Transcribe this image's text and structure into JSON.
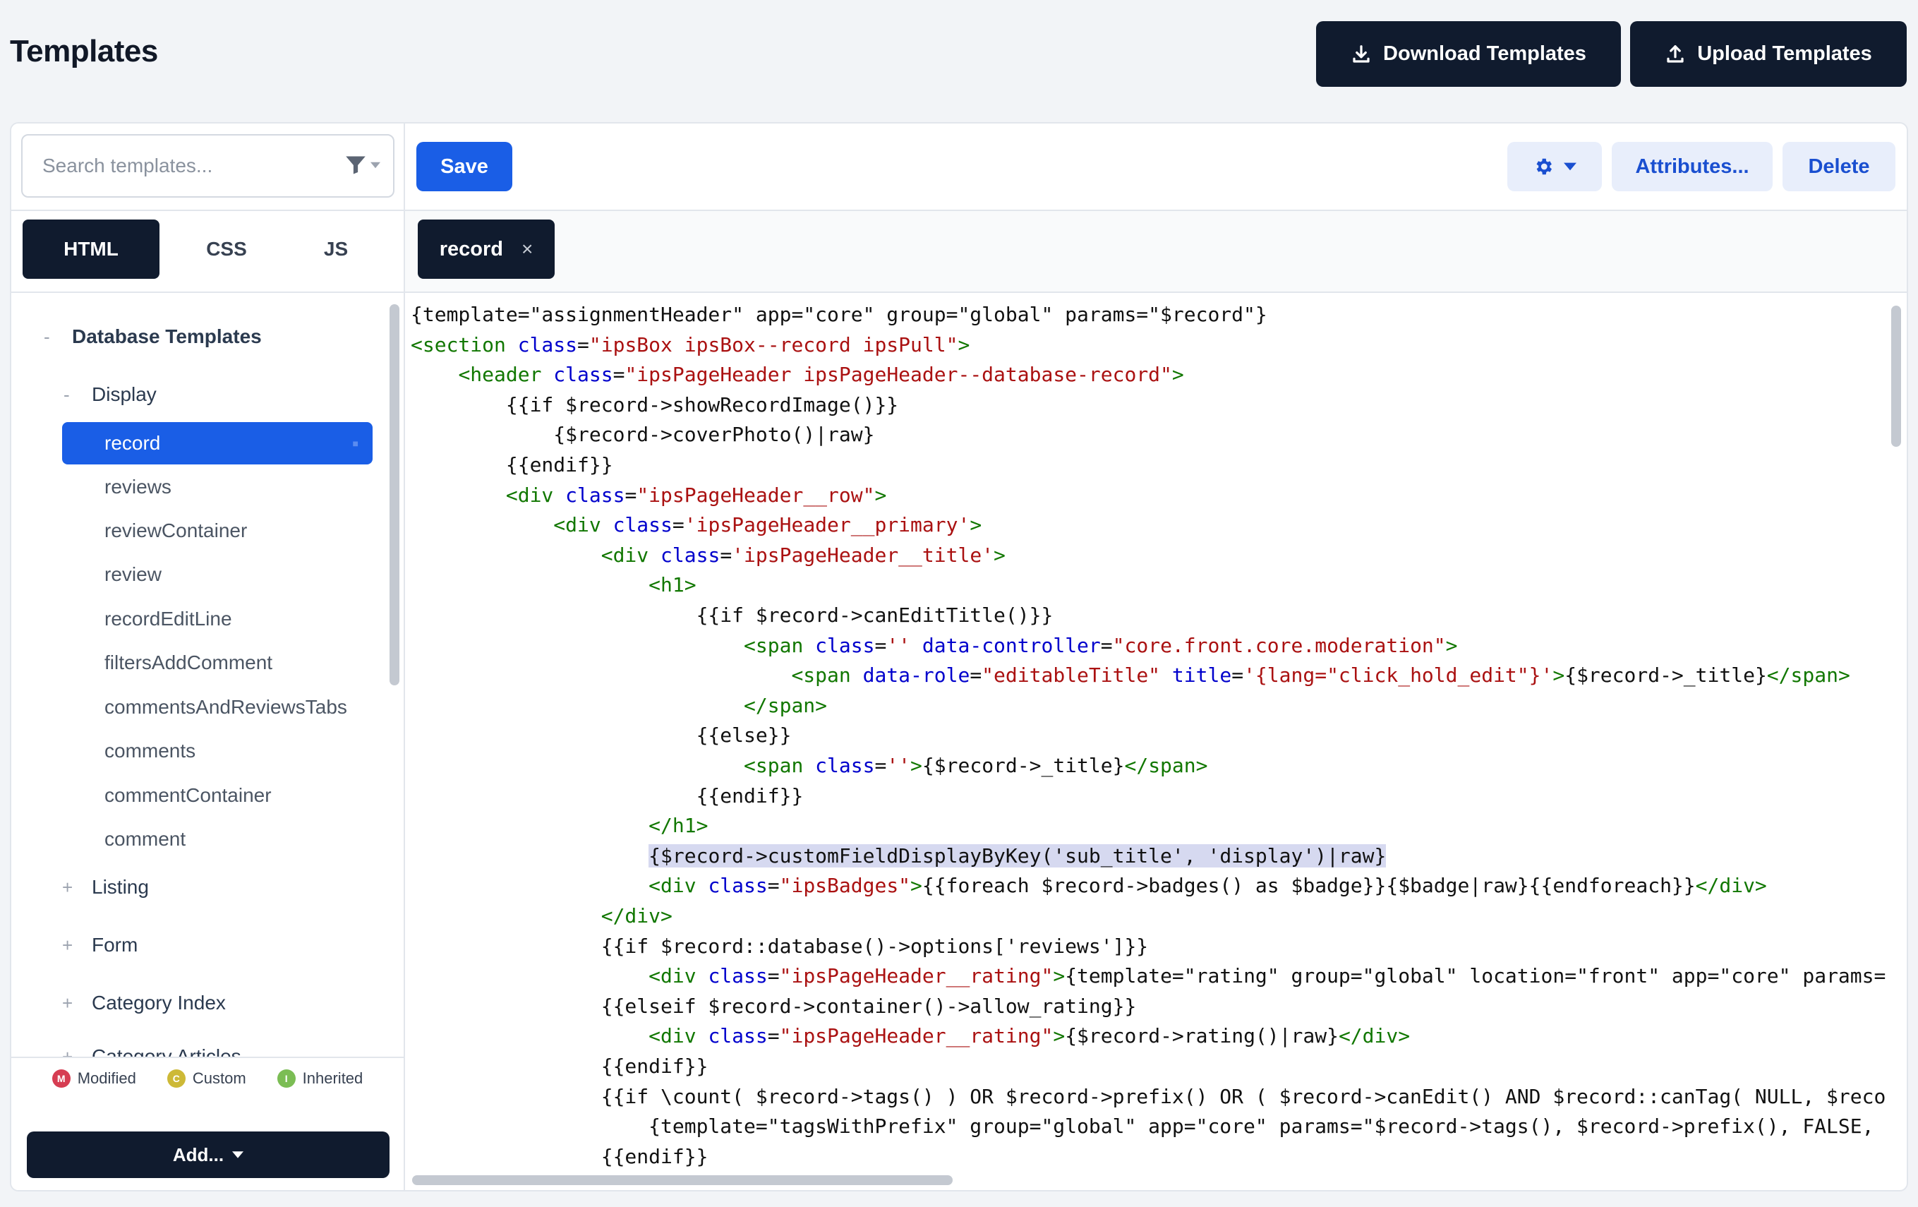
{
  "page": {
    "title": "Templates"
  },
  "header": {
    "download_label": "Download Templates",
    "upload_label": "Upload Templates"
  },
  "sidebar": {
    "search_placeholder": "Search templates...",
    "tabs": [
      {
        "label": "HTML",
        "active": true
      },
      {
        "label": "CSS",
        "active": false
      },
      {
        "label": "JS",
        "active": false
      }
    ],
    "tree": {
      "root_label": "Database Templates",
      "display_label": "Display",
      "display_items": [
        {
          "label": "record",
          "active": true
        },
        {
          "label": "reviews"
        },
        {
          "label": "reviewContainer"
        },
        {
          "label": "review"
        },
        {
          "label": "recordEditLine"
        },
        {
          "label": "filtersAddComment"
        },
        {
          "label": "commentsAndReviewsTabs"
        },
        {
          "label": "comments"
        },
        {
          "label": "commentContainer"
        },
        {
          "label": "comment"
        }
      ],
      "groups": [
        "Listing",
        "Form",
        "Category Index",
        "Category Articles"
      ]
    },
    "legend": [
      {
        "badge": "M",
        "label": "Modified",
        "color": "#d63d52"
      },
      {
        "badge": "C",
        "label": "Custom",
        "color": "#cdb937"
      },
      {
        "badge": "I",
        "label": "Inherited",
        "color": "#7bbd54"
      }
    ],
    "add_label": "Add..."
  },
  "editor": {
    "save_label": "Save",
    "attributes_label": "Attributes...",
    "delete_label": "Delete",
    "open_tab": "record",
    "colors": {
      "tag": "#117700",
      "attr": "#0000cc",
      "string": "#aa1111",
      "highlight": "#d6d9f0"
    },
    "code_lines": [
      [
        [
          "t",
          "{template=\"assignmentHeader\" app=\"core\" group=\"global\" params=\"$record\"}"
        ]
      ],
      [
        [
          "g",
          "<section "
        ],
        [
          "a",
          "class"
        ],
        [
          "t",
          "="
        ],
        [
          "s",
          "\"ipsBox ipsBox--record ipsPull\""
        ],
        [
          "g",
          ">"
        ]
      ],
      [
        [
          "t",
          "    "
        ],
        [
          "g",
          "<header "
        ],
        [
          "a",
          "class"
        ],
        [
          "t",
          "="
        ],
        [
          "s",
          "\"ipsPageHeader ipsPageHeader--database-record\""
        ],
        [
          "g",
          ">"
        ]
      ],
      [
        [
          "t",
          "        {{if $record->showRecordImage()}}"
        ]
      ],
      [
        [
          "t",
          "            {$record->coverPhoto()|raw}"
        ]
      ],
      [
        [
          "t",
          "        {{endif}}"
        ]
      ],
      [
        [
          "t",
          "        "
        ],
        [
          "g",
          "<div "
        ],
        [
          "a",
          "class"
        ],
        [
          "t",
          "="
        ],
        [
          "s",
          "\"ipsPageHeader__row\""
        ],
        [
          "g",
          ">"
        ]
      ],
      [
        [
          "t",
          "            "
        ],
        [
          "g",
          "<div "
        ],
        [
          "a",
          "class"
        ],
        [
          "t",
          "="
        ],
        [
          "s",
          "'ipsPageHeader__primary'"
        ],
        [
          "g",
          ">"
        ]
      ],
      [
        [
          "t",
          "                "
        ],
        [
          "g",
          "<div "
        ],
        [
          "a",
          "class"
        ],
        [
          "t",
          "="
        ],
        [
          "s",
          "'ipsPageHeader__title'"
        ],
        [
          "g",
          ">"
        ]
      ],
      [
        [
          "t",
          "                    "
        ],
        [
          "g",
          "<h1>"
        ]
      ],
      [
        [
          "t",
          "                        {{if $record->canEditTitle()}}"
        ]
      ],
      [
        [
          "t",
          "                            "
        ],
        [
          "g",
          "<span "
        ],
        [
          "a",
          "class"
        ],
        [
          "t",
          "="
        ],
        [
          "s",
          "''"
        ],
        [
          "t",
          " "
        ],
        [
          "a",
          "data-controller"
        ],
        [
          "t",
          "="
        ],
        [
          "s",
          "\"core.front.core.moderation\""
        ],
        [
          "g",
          ">"
        ]
      ],
      [
        [
          "t",
          "                                "
        ],
        [
          "g",
          "<span "
        ],
        [
          "a",
          "data-role"
        ],
        [
          "t",
          "="
        ],
        [
          "s",
          "\"editableTitle\""
        ],
        [
          "t",
          " "
        ],
        [
          "a",
          "title"
        ],
        [
          "t",
          "="
        ],
        [
          "s",
          "'{lang=\"click_hold_edit\"}'"
        ],
        [
          "g",
          ">"
        ],
        [
          "t",
          "{$record->_title}"
        ],
        [
          "g",
          "</span>"
        ]
      ],
      [
        [
          "t",
          "                            "
        ],
        [
          "g",
          "</span>"
        ]
      ],
      [
        [
          "t",
          "                        {{else}}"
        ]
      ],
      [
        [
          "t",
          "                            "
        ],
        [
          "g",
          "<span "
        ],
        [
          "a",
          "class"
        ],
        [
          "t",
          "="
        ],
        [
          "s",
          "''"
        ],
        [
          "g",
          ">"
        ],
        [
          "t",
          "{$record->_title}"
        ],
        [
          "g",
          "</span>"
        ]
      ],
      [
        [
          "t",
          "                        {{endif}}"
        ]
      ],
      [
        [
          "t",
          "                    "
        ],
        [
          "g",
          "</h1>"
        ]
      ],
      [
        [
          "t",
          "                    "
        ],
        [
          "h",
          "{$record->customFieldDisplayByKey('sub_title', 'display')|raw}"
        ]
      ],
      [
        [
          "t",
          "                    "
        ],
        [
          "g",
          "<div "
        ],
        [
          "a",
          "class"
        ],
        [
          "t",
          "="
        ],
        [
          "s",
          "\"ipsBadges\""
        ],
        [
          "g",
          ">"
        ],
        [
          "t",
          "{{foreach $record->badges() as $badge}}{$badge|raw}{{endforeach}}"
        ],
        [
          "g",
          "</div>"
        ]
      ],
      [
        [
          "t",
          "                "
        ],
        [
          "g",
          "</div>"
        ]
      ],
      [
        [
          "t",
          "                {{if $record::database()->options['reviews']}}"
        ]
      ],
      [
        [
          "t",
          "                    "
        ],
        [
          "g",
          "<div "
        ],
        [
          "a",
          "class"
        ],
        [
          "t",
          "="
        ],
        [
          "s",
          "\"ipsPageHeader__rating\""
        ],
        [
          "g",
          ">"
        ],
        [
          "t",
          "{template=\"rating\" group=\"global\" location=\"front\" app=\"core\" params="
        ]
      ],
      [
        [
          "t",
          "                {{elseif $record->container()->allow_rating}}"
        ]
      ],
      [
        [
          "t",
          "                    "
        ],
        [
          "g",
          "<div "
        ],
        [
          "a",
          "class"
        ],
        [
          "t",
          "="
        ],
        [
          "s",
          "\"ipsPageHeader__rating\""
        ],
        [
          "g",
          ">"
        ],
        [
          "t",
          "{$record->rating()|raw}"
        ],
        [
          "g",
          "</div>"
        ]
      ],
      [
        [
          "t",
          "                {{endif}}"
        ]
      ],
      [
        [
          "t",
          "                {{if \\count( $record->tags() ) OR $record->prefix() OR ( $record->canEdit() AND $record::canTag( NULL, $reco"
        ]
      ],
      [
        [
          "t",
          "                    {template=\"tagsWithPrefix\" group=\"global\" app=\"core\" params=\"$record->tags(), $record->prefix(), FALSE,"
        ]
      ],
      [
        [
          "t",
          "                {{endif}}"
        ]
      ]
    ]
  }
}
